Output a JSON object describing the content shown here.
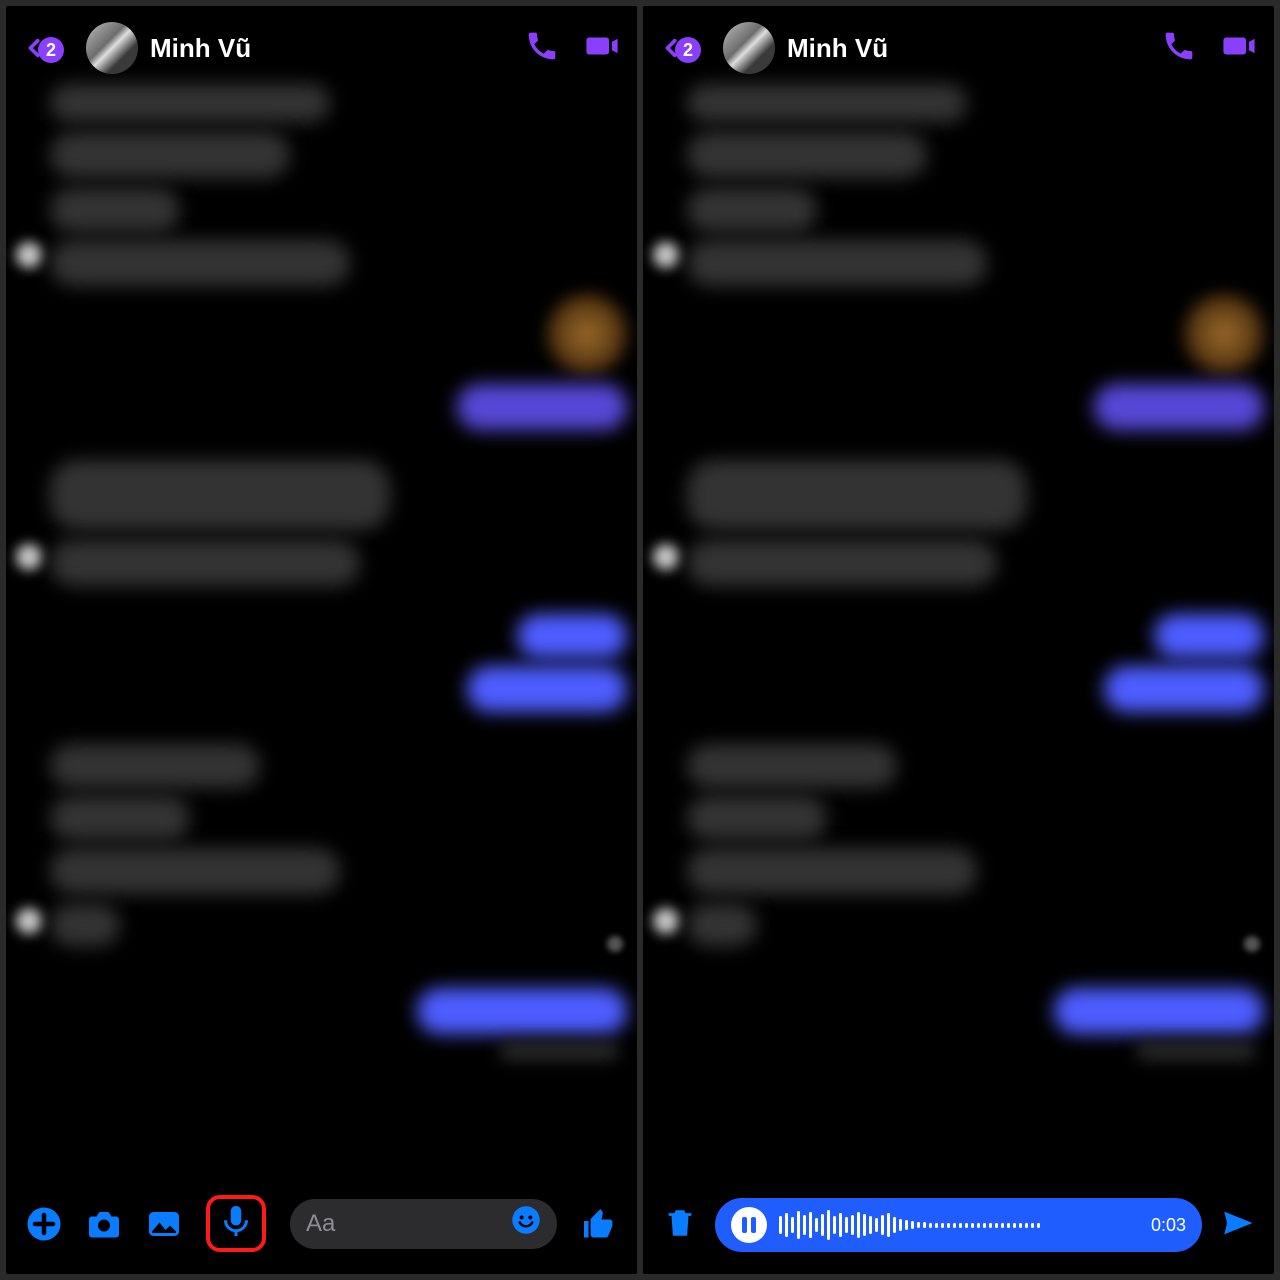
{
  "colors": {
    "accent_purple": "#8a3ffc",
    "accent_blue": "#1f5dff",
    "toolbar_blue": "#0a7cff",
    "highlight_red": "#ff1a1a"
  },
  "header": {
    "back_badge": "2",
    "contact_name": "Minh Vũ"
  },
  "compose": {
    "placeholder": "Aa"
  },
  "recording": {
    "timer": "0:03"
  },
  "icons": {
    "back": "chevron-left-icon",
    "phone": "phone-icon",
    "video": "video-icon",
    "plus": "plus-circle-icon",
    "camera": "camera-icon",
    "gallery": "gallery-icon",
    "mic": "microphone-icon",
    "emoji": "emoji-icon",
    "like": "thumbs-up-icon",
    "trash": "trash-icon",
    "pause": "pause-icon",
    "send": "send-icon"
  }
}
